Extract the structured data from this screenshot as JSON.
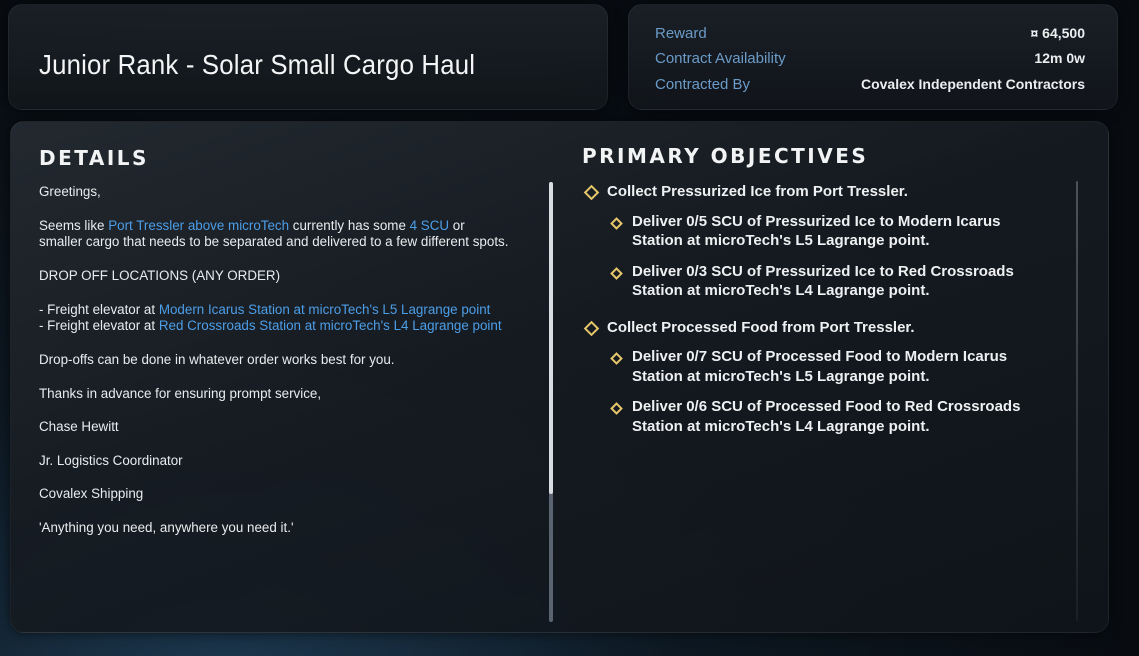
{
  "header": {
    "title": "Junior Rank - Solar Small Cargo Haul"
  },
  "info": {
    "reward_label": "Reward",
    "reward_value": "¤ 64,500",
    "availability_label": "Contract Availability",
    "availability_value": "12m 0w",
    "contracted_by_label": "Contracted By",
    "contracted_by_value": "Covalex Independent Contractors"
  },
  "details": {
    "heading": "DETAILS",
    "greeting": "Greetings,",
    "p1_a": "Seems like ",
    "p1_link1": "Port Tressler above microTech",
    "p1_b": " currently has some ",
    "p1_link2": "4 SCU",
    "p1_c": " or smaller cargo that needs to be separated and delivered to a few different spots.",
    "dropoff_heading": "DROP OFF LOCATIONS (ANY ORDER)",
    "loc1_prefix": "- Freight elevator at ",
    "loc1_link": "Modern Icarus Station at microTech's L5 Lagrange point",
    "loc2_prefix": "- Freight elevator at ",
    "loc2_link": "Red Crossroads Station at microTech's L4 Lagrange point",
    "p_order": "Drop-offs can be done in whatever order works best for you.",
    "p_thanks": "Thanks in advance for ensuring prompt service,",
    "sig_name": "Chase Hewitt",
    "sig_title": "Jr. Logistics Coordinator",
    "sig_company": "Covalex Shipping",
    "sig_motto": "'Anything you need, anywhere you need it.'"
  },
  "objectives": {
    "heading": "PRIMARY OBJECTIVES",
    "items": [
      "Collect Pressurized Ice from Port Tressler.",
      "Deliver 0/5 SCU of Pressurized Ice to Modern Icarus Station at microTech's L5 Lagrange point.",
      "Deliver 0/3 SCU of Pressurized Ice to Red Crossroads Station at microTech's L4 Lagrange point.",
      "Collect Processed Food from Port Tressler.",
      "Deliver 0/7 SCU of Processed Food to Modern Icarus Station at microTech's L5 Lagrange point.",
      "Deliver 0/6 SCU of Processed Food to Red Crossroads Station at microTech's L4 Lagrange point."
    ]
  },
  "colors": {
    "accent_link": "#4c9ee8",
    "label_blue": "#6b9bc8",
    "objective_marker": "#e8c76a"
  },
  "icons": {
    "objective_marker": "diamond-icon",
    "currency": "auec-currency-icon"
  }
}
